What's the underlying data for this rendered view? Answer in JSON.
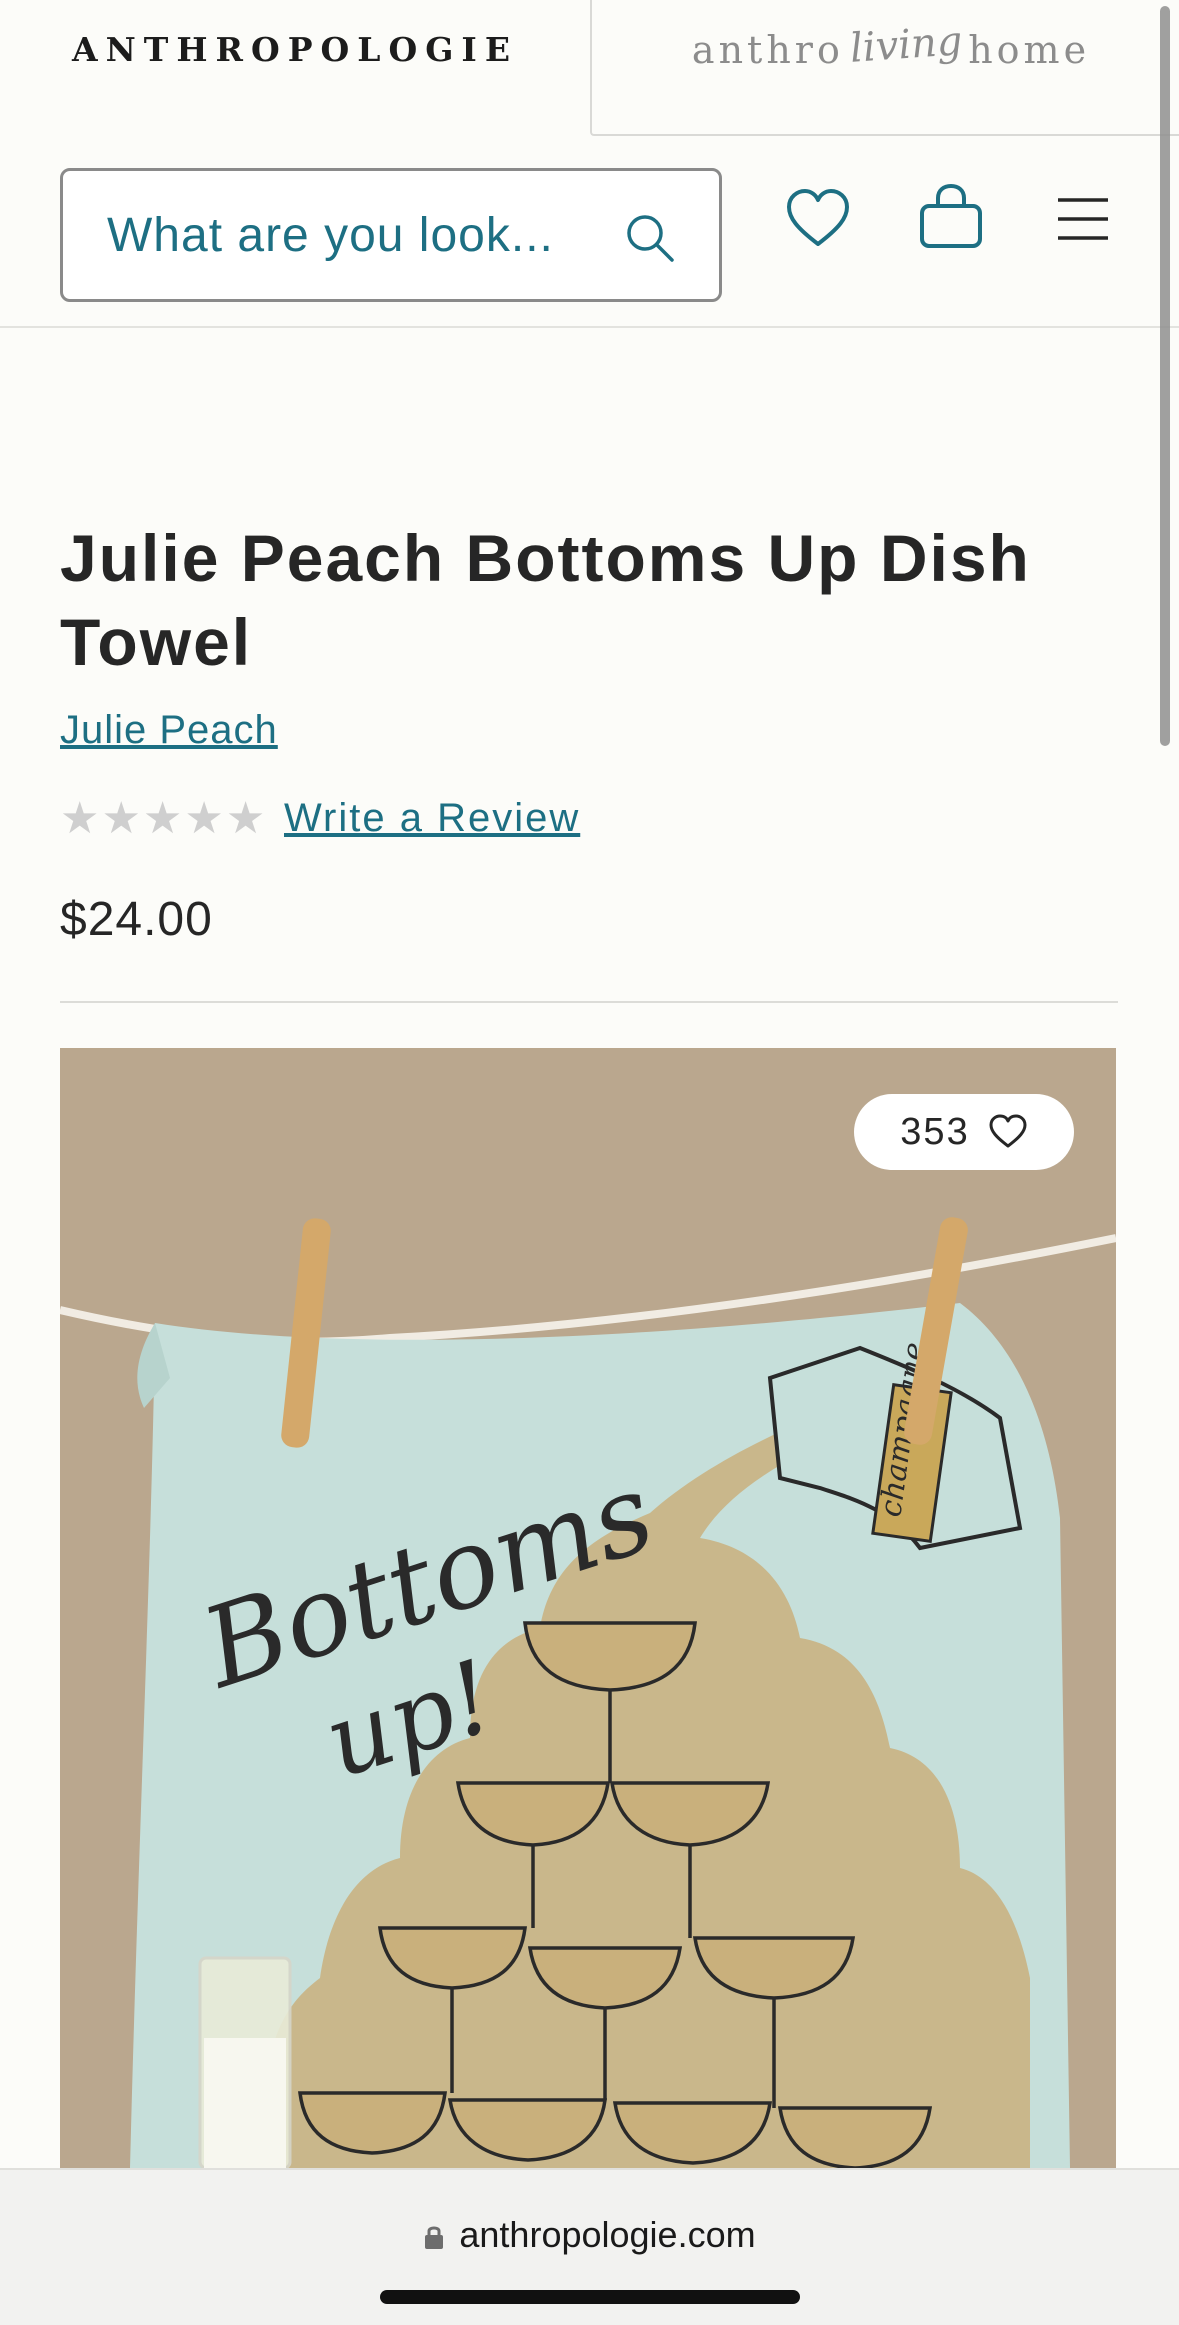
{
  "brand_tabs": {
    "primary": "ANTHROPOLOGIE",
    "secondary_part1": "anthro",
    "secondary_part2": "living",
    "secondary_part3": "home"
  },
  "header": {
    "search_placeholder": "What are you look...",
    "icons": [
      "search-icon",
      "heart-icon",
      "bag-icon",
      "menu-icon"
    ]
  },
  "product": {
    "title": "Julie Peach Bottoms Up Dish Towel",
    "brand": "Julie Peach",
    "rating_stars": 0,
    "review_link": "Write a Review",
    "price": "$24.00",
    "like_count": "353"
  },
  "image": {
    "lettering": [
      "Bottoms",
      "up!",
      "champagne"
    ]
  },
  "browser": {
    "url": "anthropologie.com"
  },
  "colors": {
    "accent": "#1d6f83",
    "background": "#fcfcf9",
    "text": "#262626",
    "star_empty": "#cfcfcf"
  }
}
